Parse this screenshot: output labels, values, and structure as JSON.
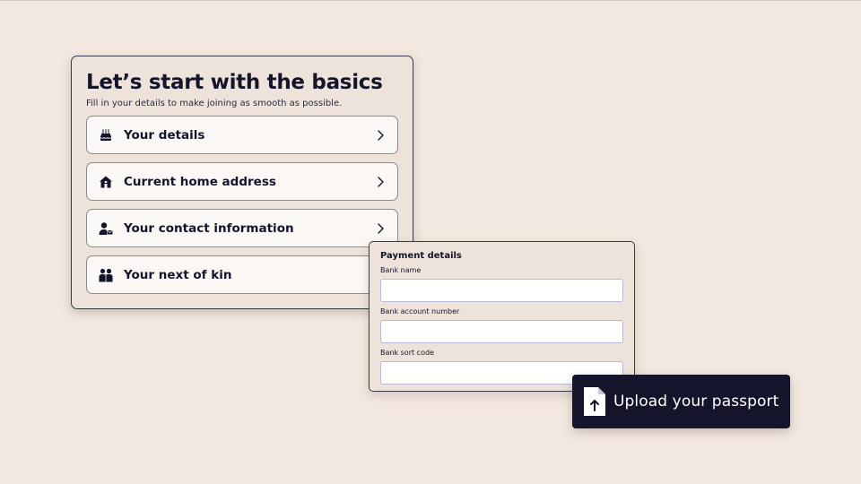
{
  "basics": {
    "title": "Let’s start with the basics",
    "subtitle": "Fill in your details to make joining as smooth as possible.",
    "items": [
      {
        "label": "Your details",
        "icon": "cake-icon"
      },
      {
        "label": "Current home address",
        "icon": "house-icon"
      },
      {
        "label": "Your contact information",
        "icon": "contact-icon"
      },
      {
        "label": "Your next of kin",
        "icon": "people-icon"
      }
    ]
  },
  "payment": {
    "title": "Payment details",
    "fields": [
      {
        "label": "Bank name",
        "value": "",
        "placeholder": ""
      },
      {
        "label": "Bank account number",
        "value": "",
        "placeholder": ""
      },
      {
        "label": "Bank sort code",
        "value": "",
        "placeholder": ""
      }
    ]
  },
  "upload": {
    "label": "Upload your passport",
    "icon": "upload-file-icon"
  },
  "colors": {
    "background": "#f3e8df",
    "card": "#ede3db",
    "item": "#faf7f4",
    "primary": "#14142b",
    "input_border": "#b8b8d6"
  }
}
